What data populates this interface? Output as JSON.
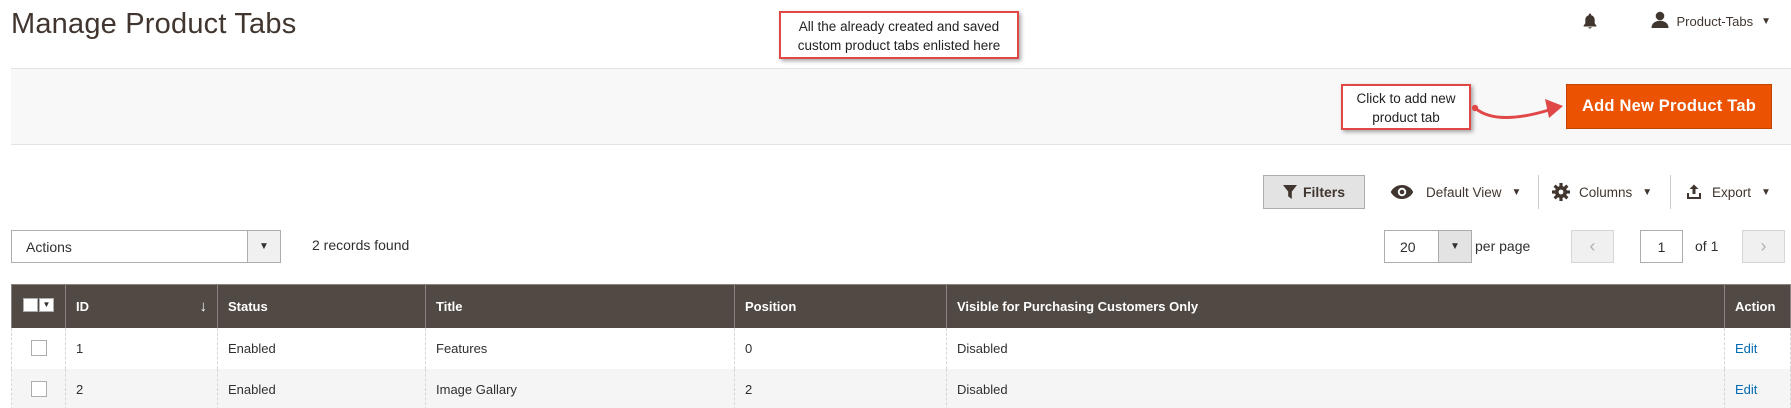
{
  "header": {
    "title": "Manage Product Tabs",
    "user_name": "Product-Tabs",
    "icons": {
      "notifications": "bell-icon",
      "user": "user-icon",
      "user_menu": "chevron-down-icon"
    }
  },
  "annotations": {
    "top_line1": "All the already created and saved",
    "top_line2": "custom product tabs enlisted here",
    "add_line1": "Click to add new",
    "add_line2": "product tab"
  },
  "action_bar": {
    "add_button": "Add New Product Tab"
  },
  "toolbar": {
    "filters": "Filters",
    "default_view": "Default View",
    "columns": "Columns",
    "export": "Export"
  },
  "grid_controls": {
    "actions_label": "Actions",
    "records_found": "2 records found",
    "per_page_value": "20",
    "per_page_label": "per page",
    "current_page": "1",
    "page_of": "of 1"
  },
  "table": {
    "columns": [
      "ID",
      "Status",
      "Title",
      "Position",
      "Visible for Purchasing Customers Only",
      "Action"
    ],
    "rows": [
      {
        "id": "1",
        "status": "Enabled",
        "title": "Features",
        "position": "0",
        "visible": "Disabled",
        "action": "Edit"
      },
      {
        "id": "2",
        "status": "Enabled",
        "title": "Image Gallary",
        "position": "2",
        "visible": "Disabled",
        "action": "Edit"
      }
    ]
  },
  "colors": {
    "primary_button": "#eb5202",
    "table_header": "#514943",
    "annotation_border": "#e04848",
    "link": "#006bb4"
  }
}
